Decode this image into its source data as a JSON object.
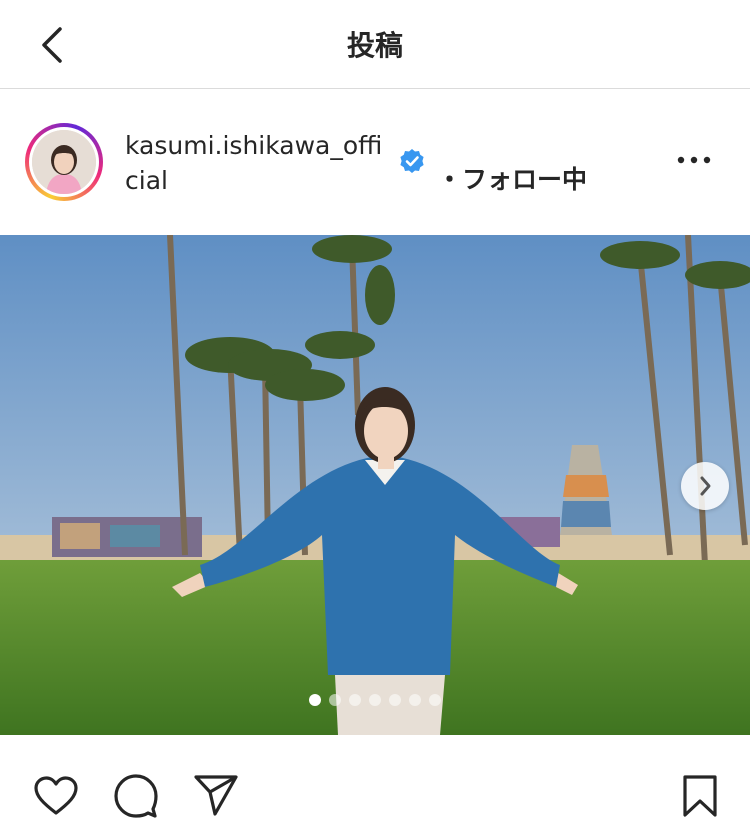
{
  "header": {
    "title": "投稿",
    "back_icon": "chevron-left-icon"
  },
  "profile": {
    "username": "kasumi.ishikawa_official",
    "verified": true,
    "follow_status": "・フォロー中",
    "more_icon": "more-horizontal-icon"
  },
  "carousel": {
    "total_slides": 7,
    "current_slide": 1,
    "next_icon": "chevron-right-icon"
  },
  "actions": {
    "like_icon": "heart-icon",
    "comment_icon": "comment-icon",
    "share_icon": "send-icon",
    "save_icon": "bookmark-icon"
  },
  "colors": {
    "text": "#262626",
    "verified_blue": "#3897f0",
    "divider": "#dbdbdb"
  }
}
